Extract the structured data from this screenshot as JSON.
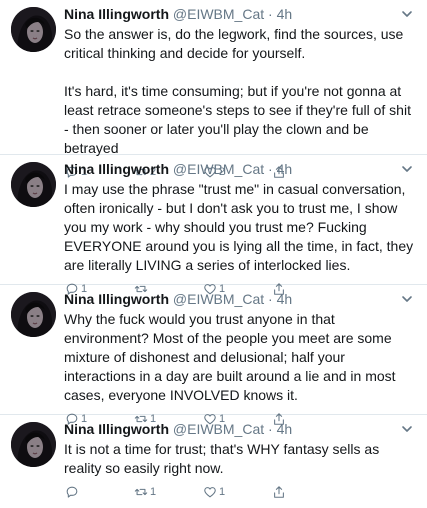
{
  "tweets": [
    {
      "author": "Nina Illingworth",
      "handle": "@EIWBM_Cat",
      "dot": "·",
      "time": "4h",
      "paragraphs": [
        "So the answer is, do the legwork, find the sources, use critical thinking and decide for yourself.",
        "It's hard, it's time consuming; but if you're not gonna at least retrace someone's steps to see if they're full of shit - then sooner or later you'll play the clown and be betrayed"
      ],
      "replies": "1",
      "retweets": "2",
      "likes": "2"
    },
    {
      "author": "Nina Illingworth",
      "handle": "@EIWBM_Cat",
      "dot": "·",
      "time": "4h",
      "paragraphs": [
        "I may use the phrase \"trust me\" in casual conversation, often ironically - but I don't ask you to trust me, I show you my work - why should you trust me? Fucking EVERYONE around you is lying all the time, in fact, they are literally LIVING a series of interlocked lies."
      ],
      "replies": "1",
      "retweets": "",
      "likes": "1"
    },
    {
      "author": "Nina Illingworth",
      "handle": "@EIWBM_Cat",
      "dot": "·",
      "time": "4h",
      "paragraphs": [
        "Why the fuck would you trust anyone in that environment? Most of the people you meet are some mixture of dishonest and delusional; half your interactions in a day are built around a lie and in most cases, everyone INVOLVED knows it."
      ],
      "replies": "1",
      "retweets": "1",
      "likes": "1"
    },
    {
      "author": "Nina Illingworth",
      "handle": "@EIWBM_Cat",
      "dot": "·",
      "time": "4h",
      "paragraphs": [
        "It is not a time for trust; that's WHY fantasy sells as reality so easily right now."
      ],
      "replies": "",
      "retweets": "1",
      "likes": "1"
    }
  ],
  "colors": {
    "text": "#14171a",
    "secondary": "#657786",
    "divider": "#e1e8ed"
  },
  "icons": [
    "avatar-image",
    "chevron-down-icon",
    "reply-icon",
    "retweet-icon",
    "like-icon",
    "share-icon"
  ]
}
